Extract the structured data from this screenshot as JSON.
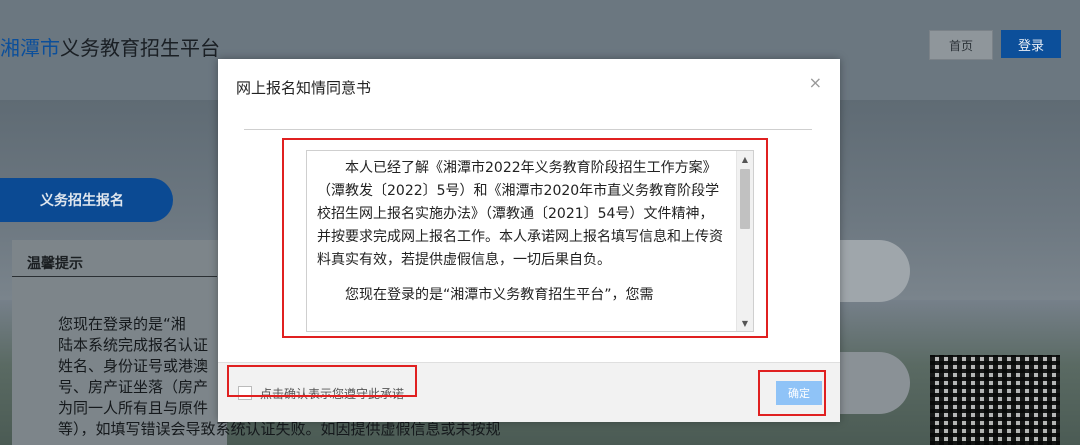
{
  "header": {
    "brand_blue": "湘潭市",
    "brand_rest": "义务教育招生平台",
    "nav_home": "首页",
    "nav_login": "登录"
  },
  "left": {
    "tab_label": "义务招生报名",
    "tips_title": "温馨提示",
    "tips_text": "您现在登录的是“湘\n陆本系统完成报名认证\n姓名、身份证号或港澳\n号、房产证坐落（房产\n为同一人所有且与原件\n等），如填写错误会导致系统认证失败。如因提供虚假信息或未按规"
  },
  "modal": {
    "title": "网上报名知情同意书",
    "close_glyph": "×",
    "notice_paragraph_1": "本人已经了解《湘潭市2022年义务教育阶段招生工作方案》（潭教发〔2022〕5号）和《湘潭市2020年市直义务教育阶段学校招生网上报名实施办法》（潭教通〔2021〕54号）文件精神，并按要求完成网上报名工作。本人承诺网上报名填写信息和上传资料真实有效，若提供虚假信息，一切后果自负。",
    "notice_paragraph_2": "您现在登录的是“湘潭市义务教育招生平台”，您需",
    "scroll_up_glyph": "▲",
    "scroll_down_glyph": "▼",
    "agree_label": "点击确认表示您遵守此承诺",
    "confirm_label": "确定"
  },
  "colors": {
    "brand_blue": "#0c4f9a",
    "annotation_red": "#e02020",
    "confirm_blue": "#8fc3f7"
  }
}
